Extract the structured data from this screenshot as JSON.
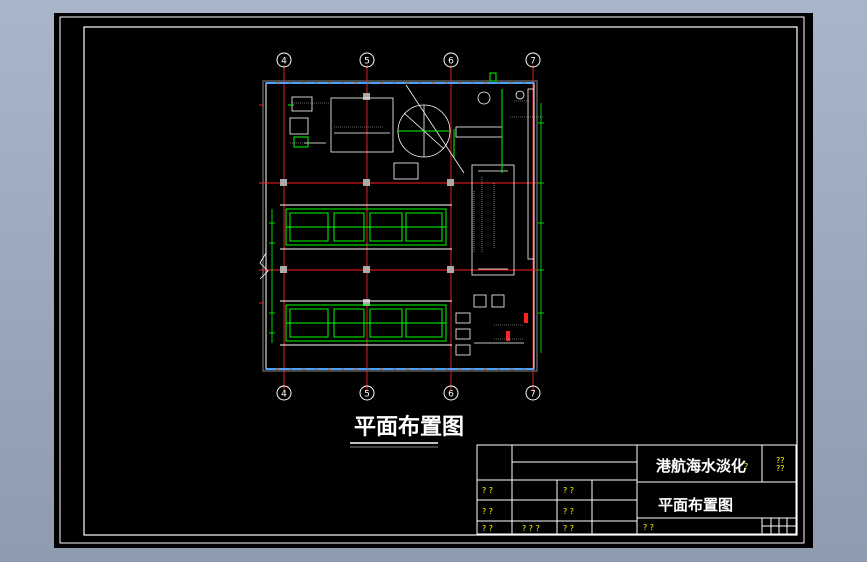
{
  "drawing": {
    "main_title": "平面布置图",
    "axes_top": [
      "4",
      "5",
      "6",
      "7"
    ],
    "axes_bottom": [
      "4",
      "5",
      "6",
      "7"
    ]
  },
  "title_block": {
    "project_name": "港航海水淡化",
    "project_suffix": "?",
    "sheet_title": "平面布置图",
    "code_top": "??",
    "code_bottom": "??",
    "cell_qq": "? ?",
    "cell_qqq": "? ? ?"
  },
  "colors": {
    "background": "#000000",
    "frame": "#ffffff",
    "grid_axis": "#ff0000",
    "equipment": "#00ff00",
    "annotation": "#ffffff",
    "unknown_chars": "#ffff00"
  }
}
